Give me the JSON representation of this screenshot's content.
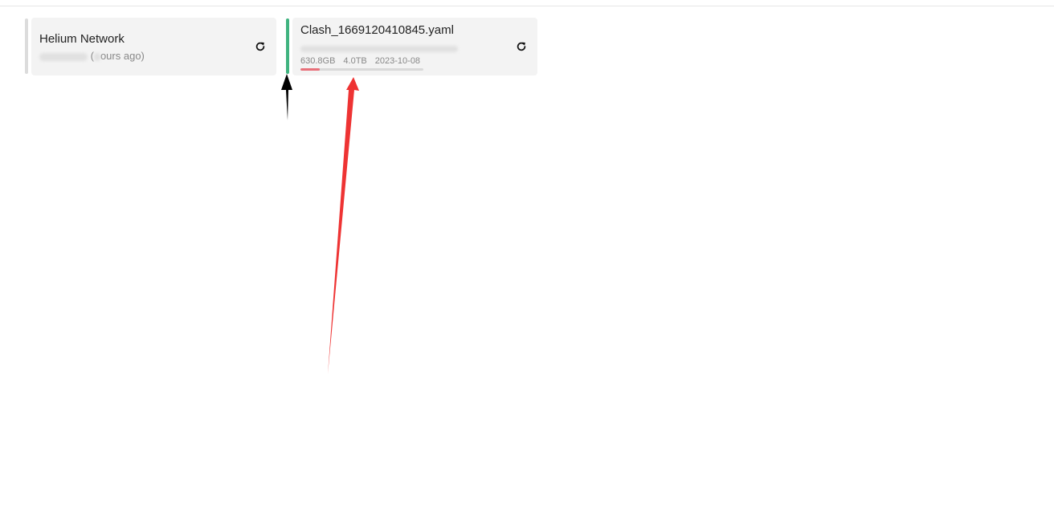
{
  "colors": {
    "indicator_inactive": "#dcdcdc",
    "indicator_active": "#3fb37f",
    "progress_fill": "#e8707a",
    "annotation_black": "#000000",
    "annotation_red": "#ee3333"
  },
  "providers": [
    {
      "name": "Helium Network",
      "sub_suffix": "ours ago)",
      "refresh_icon": "refresh-icon"
    },
    {
      "name": "Clash_1669120410845.yaml",
      "used": "630.8GB",
      "total": "4.0TB",
      "expire": "2023-10-08",
      "usage_fraction": 0.158,
      "refresh_icon": "refresh-icon"
    }
  ],
  "annotations": [
    {
      "name": "black-arrow",
      "color": "#000000"
    },
    {
      "name": "red-arrow",
      "color": "#ee3333"
    }
  ]
}
